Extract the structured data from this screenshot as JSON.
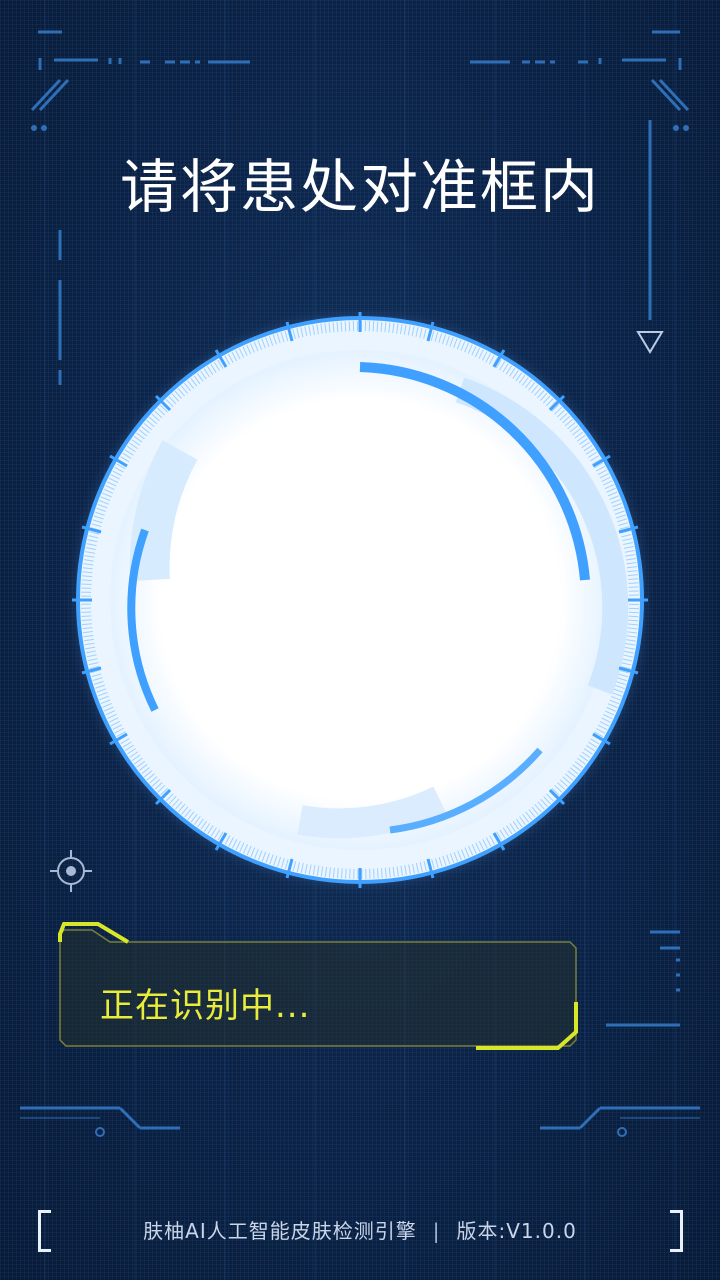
{
  "header": {
    "title": "请将患处对准框内"
  },
  "status": {
    "text": "正在识别中..."
  },
  "footer": {
    "engine": "肤柚AI人工智能皮肤检测引擎",
    "separator": "|",
    "version": "版本:V1.0.0"
  },
  "colors": {
    "accent_blue": "#3fa0ff",
    "status_yellow": "#e8ec3a",
    "background": "#0b2146"
  },
  "icons": {
    "target": "crosshair-icon",
    "arrow": "triangle-down-icon"
  }
}
